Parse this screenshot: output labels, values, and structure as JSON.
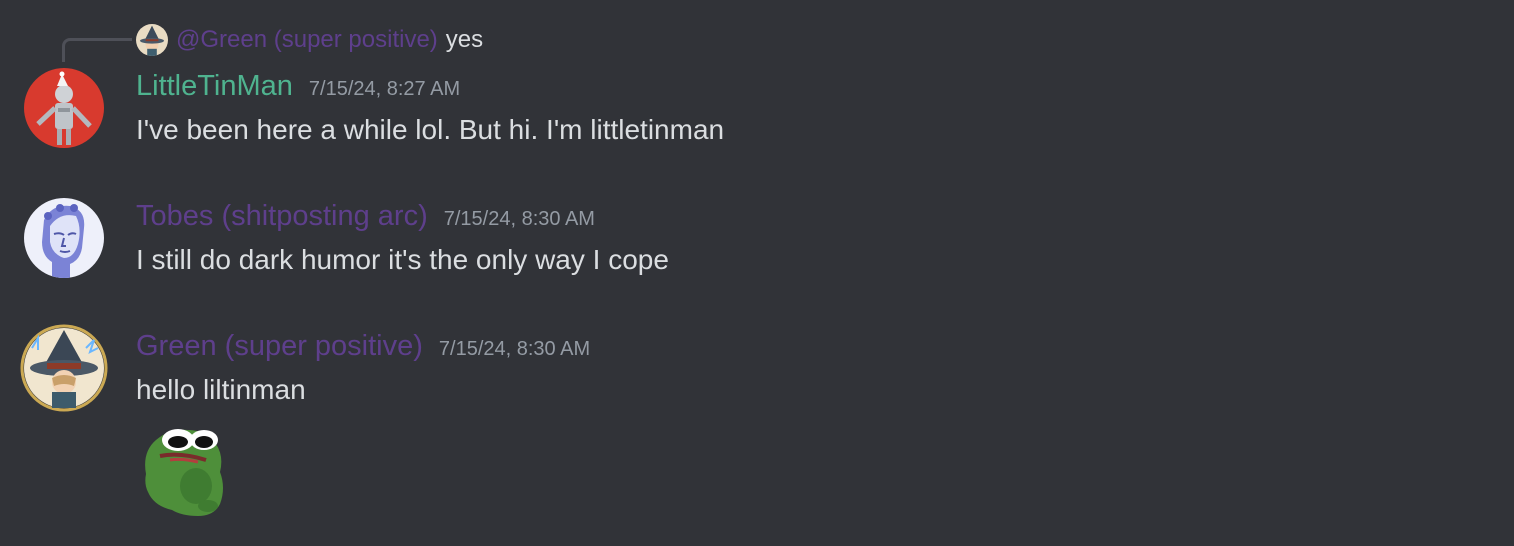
{
  "reply": {
    "mention": "@Green (super positive)",
    "text": "yes"
  },
  "messages": [
    {
      "username": "LittleTinMan",
      "username_color": "#4fb38f",
      "timestamp": "7/15/24, 8:27 AM",
      "text": "I've been here a while lol. But hi. I'm littletinman",
      "avatar": "tin-man-avatar"
    },
    {
      "username": "Tobes (shitposting arc)",
      "username_color": "#5e3f8c",
      "timestamp": "7/15/24, 8:30 AM",
      "text": "I still do dark humor it's the only way I cope",
      "avatar": "statue-avatar"
    },
    {
      "username": "Green (super positive)",
      "username_color": "#5e3f8c",
      "timestamp": "7/15/24, 8:30 AM",
      "text": "hello liltinman",
      "avatar": "wizard-avatar",
      "sticker": "sad-frog-sticker"
    }
  ]
}
